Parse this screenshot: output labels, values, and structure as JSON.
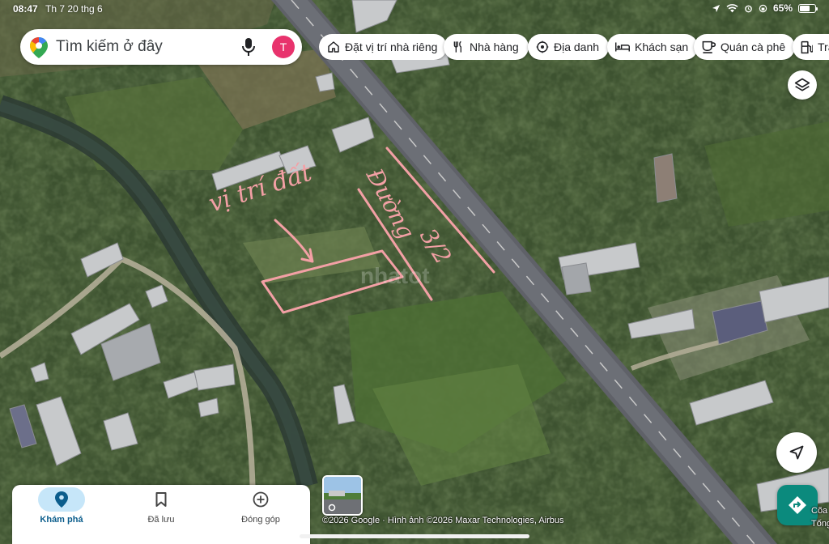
{
  "status_bar": {
    "time": "08:47",
    "date": "Th 7 20 thg 6",
    "battery": "65%"
  },
  "search": {
    "placeholder": "Tìm kiếm ở đây",
    "avatar_letter": "T"
  },
  "chips": [
    {
      "label": "Đặt vị trí nhà riêng",
      "icon": "home-icon"
    },
    {
      "label": "Nhà hàng",
      "icon": "restaurant-icon"
    },
    {
      "label": "Địa danh",
      "icon": "landmark-icon"
    },
    {
      "label": "Khách sạn",
      "icon": "hotel-icon"
    },
    {
      "label": "Quán cà phê",
      "icon": "coffee-icon"
    },
    {
      "label": "Trạm xăng",
      "icon": "gas-station-icon"
    }
  ],
  "map": {
    "annotation_location": "vị trí đất",
    "annotation_road": "Đường",
    "annotation_road_number": "3/2",
    "watermark": "nhatot",
    "place_label": "Cõa\nTống Yến",
    "attribution": "©2026 Google · Hình ảnh ©2026 Maxar Technologies, Airbus"
  },
  "bottom_nav": [
    {
      "label": "Khám phá",
      "icon": "explore-pin-icon",
      "active": true
    },
    {
      "label": "Đã lưu",
      "icon": "bookmark-icon",
      "active": false
    },
    {
      "label": "Đóng góp",
      "icon": "add-circle-icon",
      "active": false
    }
  ],
  "colors": {
    "annotation": "#f3a0a5",
    "accent": "#0b8a7d",
    "active_nav": "#c6e6f9",
    "avatar": "#e8336d"
  }
}
